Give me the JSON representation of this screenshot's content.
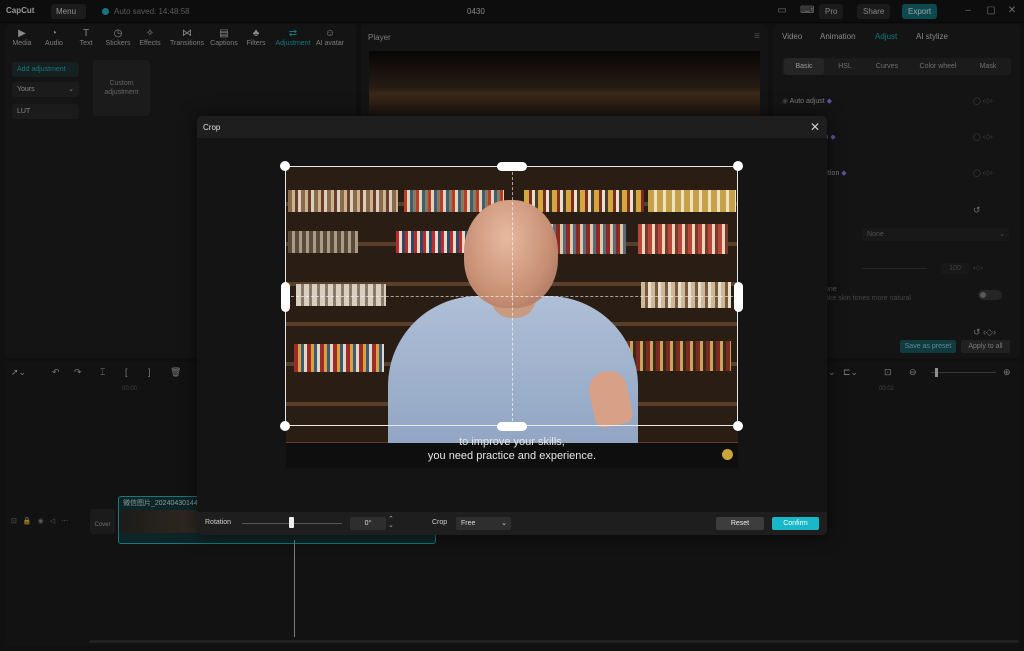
{
  "app": {
    "logo": "CapCut",
    "menu_label": "Menu",
    "autosave": "Auto saved: 14:48:58",
    "project_name": "0430",
    "pro_label": "Pro",
    "share_label": "Share",
    "export_label": "Export"
  },
  "toolbar": {
    "tools": [
      {
        "label": "Media",
        "icon": "media-icon"
      },
      {
        "label": "Audio",
        "icon": "audio-icon"
      },
      {
        "label": "Text",
        "icon": "text-icon"
      },
      {
        "label": "Stickers",
        "icon": "stickers-icon"
      },
      {
        "label": "Effects",
        "icon": "effects-icon"
      },
      {
        "label": "Transitions",
        "icon": "transitions-icon"
      },
      {
        "label": "Captions",
        "icon": "captions-icon"
      },
      {
        "label": "Filters",
        "icon": "filters-icon"
      },
      {
        "label": "Adjustment",
        "icon": "adjustment-icon"
      },
      {
        "label": "AI avatar",
        "icon": "ai-avatar-icon"
      }
    ]
  },
  "left_sidebar": {
    "items": [
      "Add adjustment",
      "Yours",
      "LUT"
    ],
    "tile_label": "Custom adjustment"
  },
  "player": {
    "title": "Player"
  },
  "right_panel": {
    "tabs": [
      "Video",
      "Animation",
      "Adjust",
      "AI stylize"
    ],
    "subtabs": [
      "Basic",
      "HSL",
      "Curves",
      "Color wheel",
      "Mask"
    ],
    "rows": [
      "Auto adjust",
      "tch",
      "rrection"
    ],
    "dropdown_value": "None",
    "slider_value": "100",
    "skin_label": "one",
    "skin_desc": "ake skin tones more natural",
    "save_preset": "Save as preset",
    "apply_all": "Apply to all"
  },
  "timeline": {
    "time_left": "00:00",
    "time_right": "00:02",
    "clip_label": "微信图片_20240430144",
    "cover_label": "Cover"
  },
  "crop_dialog": {
    "title": "Crop",
    "subtitle_line1": "to improve your skills,",
    "subtitle_line2": "you need practice and experience.",
    "rotation_label": "Rotation",
    "rotation_value": "0°",
    "crop_label": "Crop",
    "crop_value": "Free",
    "reset_label": "Reset",
    "confirm_label": "Confirm"
  },
  "colors": {
    "accent": "#1fb6c4",
    "confirm": "#19b8c9"
  }
}
